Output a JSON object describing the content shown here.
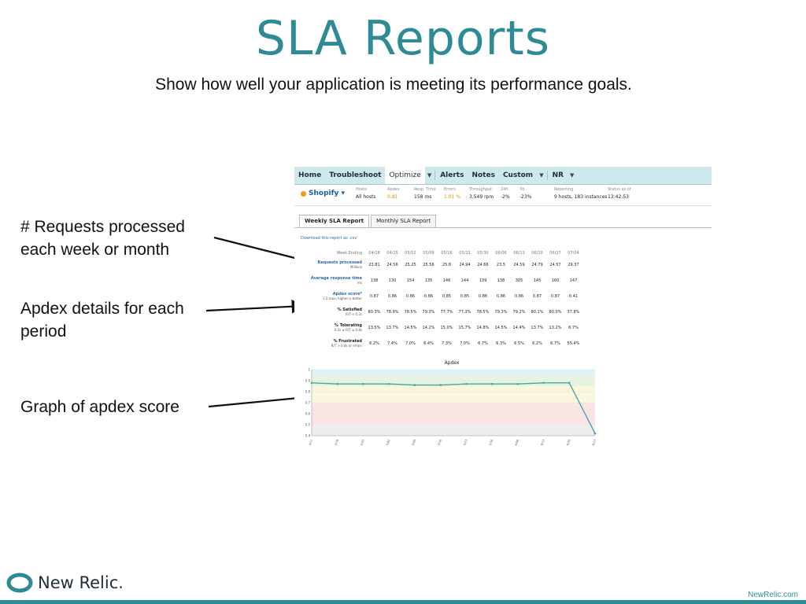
{
  "slide": {
    "title": "SLA Reports",
    "subtitle": "Show how well your application is meeting its performance goals.",
    "callouts": [
      {
        "line1": "# Requests processed",
        "line2": "each week or month"
      },
      {
        "line1": "Apdex details for each",
        "line2": "period"
      },
      {
        "line1": "Graph of apdex score",
        "line2": ""
      }
    ],
    "footer_url": "NewRelic.com",
    "brand": "New Relic."
  },
  "colors": {
    "accent": "#2e8b96",
    "nav_bg": "#cfe8ec",
    "link": "#2a6aa5",
    "warn": "#d99300"
  },
  "nav": {
    "items": [
      "Home",
      "Troubleshoot",
      "Optimize",
      "Alerts",
      "Notes",
      "Custom",
      "NR"
    ]
  },
  "appbar": {
    "app": "Shopify",
    "stats": [
      {
        "label": "Hosts",
        "value": "All hosts"
      },
      {
        "label": "Apdex",
        "value": "0.81"
      },
      {
        "label": "Resp. Time",
        "value": "158 ms"
      },
      {
        "label": "Errors",
        "value": "1.01 %"
      },
      {
        "label": "Throughput",
        "value": "3,549 rpm"
      },
      {
        "label": "24h",
        "value": "-2%"
      },
      {
        "label": "7d",
        "value": "-23%"
      },
      {
        "label": "Reporting",
        "value": "9 hosts, 183 instances"
      },
      {
        "label": "Status as of",
        "value": "13:42:53"
      }
    ]
  },
  "tabs": [
    "Weekly SLA Report",
    "Monthly SLA Report"
  ],
  "download_label": "Download this report as .csv",
  "table": {
    "header_label": "Week Ending",
    "weeks": [
      "04/18",
      "04/25",
      "05/02",
      "05/09",
      "05/16",
      "05/23",
      "05/30",
      "06/06",
      "06/13",
      "06/20",
      "06/27",
      "07/04"
    ],
    "rows": [
      {
        "label": "Requests processed",
        "sub": "Millions",
        "values": [
          "23.81",
          "24.56",
          "25.25",
          "25.56",
          "25.8",
          "24.94",
          "24.66",
          "23.5",
          "24.59",
          "24.79",
          "24.57",
          "29.37"
        ]
      },
      {
        "label": "Average response time",
        "sub": "ms",
        "values": [
          "138",
          "130",
          "154",
          "135",
          "146",
          "144",
          "139",
          "138",
          "305",
          "145",
          "160",
          "147"
        ]
      },
      {
        "label": "Apdex score*",
        "sub": "1.0 max; higher is better",
        "values": [
          "0.87",
          "0.86",
          "0.86",
          "0.86",
          "0.85",
          "0.85",
          "0.86",
          "0.86",
          "0.86",
          "0.87",
          "0.87",
          "0.41"
        ]
      },
      {
        "label": "% Satisfied",
        "sub": "R/T < 0.2s",
        "values": [
          "80.3%",
          "78.9%",
          "78.5%",
          "79.3%",
          "77.7%",
          "77.3%",
          "78.5%",
          "79.3%",
          "79.2%",
          "80.1%",
          "80.0%",
          "37.8%"
        ]
      },
      {
        "label": "% Tolerating",
        "sub": "0.2s ≤ R/T ≤ 0.8s",
        "values": [
          "13.5%",
          "13.7%",
          "14.5%",
          "14.2%",
          "15.0%",
          "15.7%",
          "14.8%",
          "14.5%",
          "14.4%",
          "13.7%",
          "13.2%",
          "6.7%"
        ]
      },
      {
        "label": "% Frustrated",
        "sub": "R/T > 0.8s or errors",
        "values": [
          "6.2%",
          "7.4%",
          "7.0%",
          "6.4%",
          "7.3%",
          "7.0%",
          "6.7%",
          "6.3%",
          "6.5%",
          "6.2%",
          "6.7%",
          "55.4%"
        ]
      }
    ]
  },
  "chart_data": {
    "type": "line",
    "title": "Apdex",
    "x": [
      "4/11",
      "4/18",
      "4/25",
      "5/02",
      "5/09",
      "5/16",
      "5/23",
      "5/30",
      "6/06",
      "6/13",
      "6/20",
      "6/27"
    ],
    "series": [
      {
        "values": [
          0.88,
          0.87,
          0.87,
          0.87,
          0.86,
          0.86,
          0.87,
          0.87,
          0.87,
          0.88,
          0.88,
          0.42
        ]
      }
    ],
    "ylim": [
      0.4,
      1.0
    ],
    "yticks": [
      "1",
      "0.9",
      "0.8",
      "0.7",
      "0.6",
      "0.5",
      "0.4"
    ],
    "bands": [
      {
        "from": 0.94,
        "to": 1.0,
        "color": "#dff2f7"
      },
      {
        "from": 0.85,
        "to": 0.94,
        "color": "#e6f5df"
      },
      {
        "from": 0.7,
        "to": 0.85,
        "color": "#fbf7dc"
      },
      {
        "from": 0.5,
        "to": 0.7,
        "color": "#fbe5e4"
      },
      {
        "from": 0.4,
        "to": 0.5,
        "color": "#eeeeee"
      }
    ],
    "line_color": "#4aa3ad"
  }
}
